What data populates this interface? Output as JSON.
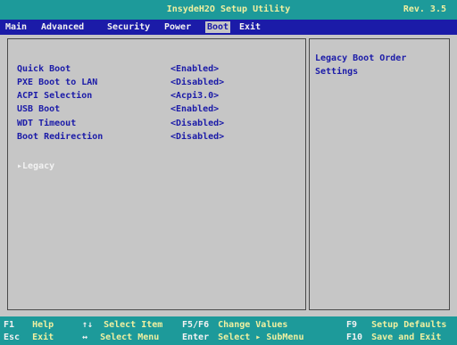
{
  "title": "InsydeH2O Setup Utility",
  "revision": "Rev. 3.5",
  "menu": [
    "Main",
    "Advanced",
    "Security",
    "Power",
    "Boot",
    "Exit"
  ],
  "active_menu": "Boot",
  "settings": [
    {
      "label": "Quick Boot",
      "value": "<Enabled>"
    },
    {
      "label": "PXE Boot to LAN",
      "value": "<Disabled>"
    },
    {
      "label": "ACPI Selection",
      "value": "<Acpi3.0>"
    },
    {
      "label": "USB Boot",
      "value": "<Enabled>"
    },
    {
      "label": "WDT Timeout",
      "value": "<Disabled>"
    },
    {
      "label": "Boot Redirection",
      "value": "<Disabled>"
    }
  ],
  "submenu": "▸Legacy",
  "help_text": "Legacy Boot Order Settings",
  "footer": [
    {
      "key": "F1",
      "desc": "Help"
    },
    {
      "key": "Esc",
      "desc": "Exit"
    },
    {
      "key": "↑↓",
      "desc": "Select Item"
    },
    {
      "key": "↔",
      "desc": "Select Menu"
    },
    {
      "key": "F5/F6",
      "desc": "Change Values"
    },
    {
      "key": "Enter",
      "desc": "Select ▸ SubMenu"
    },
    {
      "key": "F9",
      "desc": "Setup Defaults"
    },
    {
      "key": "F10",
      "desc": "Save and Exit"
    }
  ]
}
